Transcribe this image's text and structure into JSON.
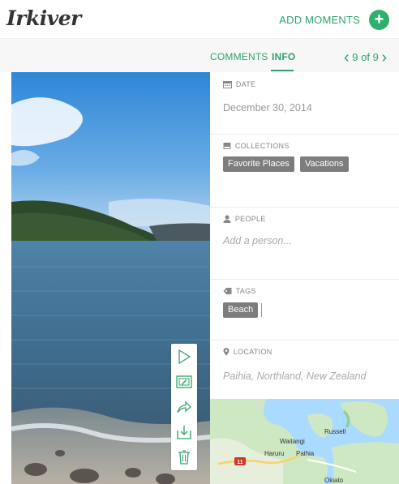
{
  "header": {
    "logo": "Irkiver",
    "add_moments": "ADD MOMENTS",
    "add_icon": "plus-circle-icon"
  },
  "tabs": {
    "comments": "COMMENTS",
    "info": "INFO",
    "active": "info"
  },
  "pager": {
    "current": "9",
    "of": "of",
    "total": "9"
  },
  "info": {
    "date": {
      "label": "DATE",
      "value": "December 30, 2014"
    },
    "collections": {
      "label": "COLLECTIONS",
      "items": [
        "Favorite Places",
        "Vacations"
      ]
    },
    "people": {
      "label": "PEOPLE",
      "placeholder": "Add a person..."
    },
    "tags": {
      "label": "TAGS",
      "items": [
        "Beach"
      ]
    },
    "location": {
      "label": "LOCATION",
      "value": "Paihia, Northland, New Zealand"
    }
  },
  "map": {
    "places": [
      "Russell",
      "Waitangi",
      "Haruru",
      "Paihia",
      "Okiato"
    ],
    "road_marker": "11"
  },
  "toolbar": {
    "icons": [
      "play-icon",
      "edit-icon",
      "share-icon",
      "download-icon",
      "trash-icon"
    ]
  },
  "colors": {
    "accent": "#2fa36b",
    "chip": "#7d7d7d"
  }
}
